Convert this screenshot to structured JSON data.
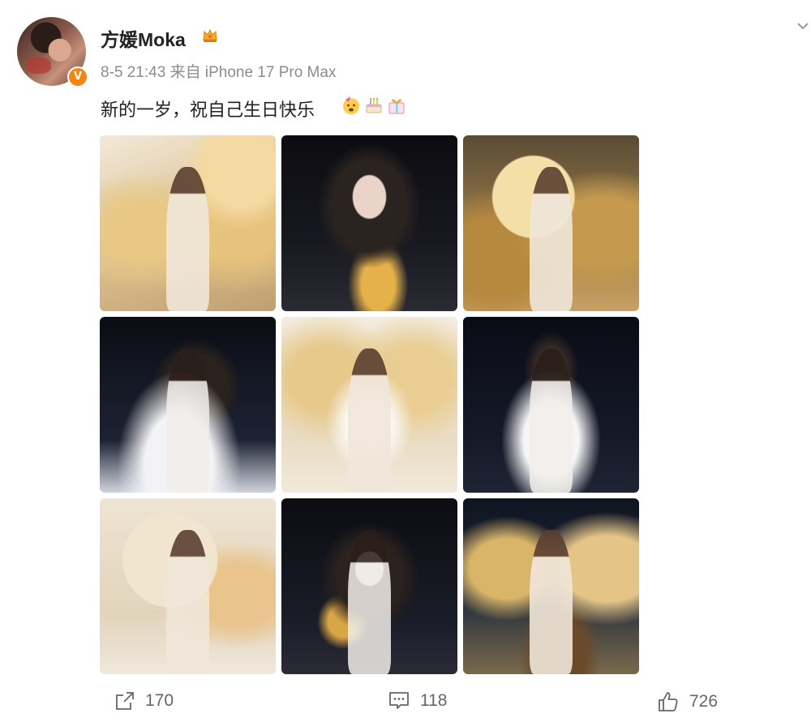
{
  "user": {
    "name": "方媛Moka",
    "badge_icon": "crown-icon",
    "verified_badge": "V"
  },
  "post": {
    "date": "8-5 21:43",
    "source": "来自 iPhone 17 Pro Max",
    "text": "新的一岁，祝自己生日快乐",
    "emojis": [
      "party-face-emoji",
      "birthday-cake-emoji",
      "gift-emoji"
    ]
  },
  "photos": [
    {
      "id": "1",
      "theme": "gold-crescent"
    },
    {
      "id": "2",
      "theme": "starry-night"
    },
    {
      "id": "3",
      "theme": "golden-moon"
    },
    {
      "id": "4",
      "theme": "starry-silk"
    },
    {
      "id": "5",
      "theme": "white-wings"
    },
    {
      "id": "6",
      "theme": "starry-gown"
    },
    {
      "id": "7",
      "theme": "full-moon-columns"
    },
    {
      "id": "8",
      "theme": "starry-golden-rose"
    },
    {
      "id": "9",
      "theme": "crescent-lion"
    }
  ],
  "actions": {
    "share_count": "170",
    "comment_count": "118",
    "like_count": "726"
  },
  "colors": {
    "accent_orange": "#f5850e",
    "meta_gray": "#8d8d8d",
    "text_dark": "#222222"
  }
}
